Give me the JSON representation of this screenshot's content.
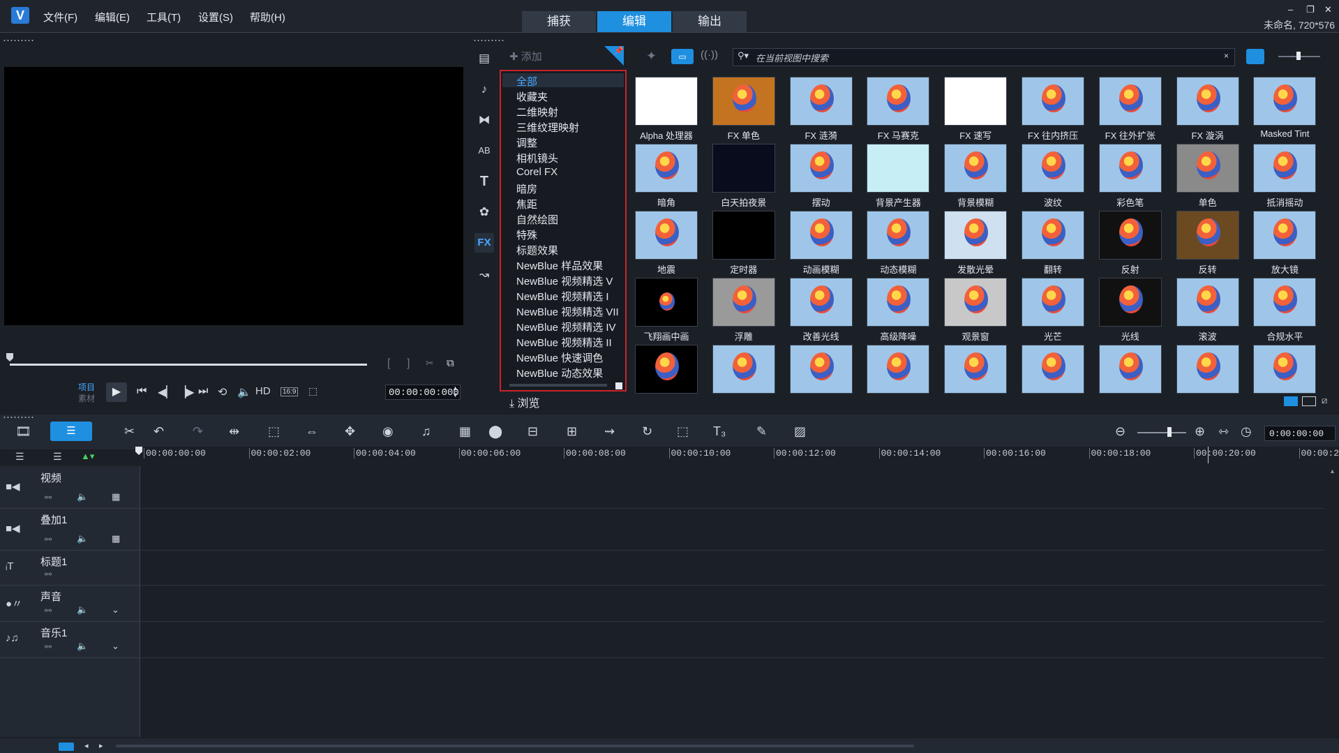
{
  "app": {
    "logo": "V",
    "caption": "未命名, 720*576"
  },
  "menu": [
    "文件(F)",
    "编辑(E)",
    "工具(T)",
    "设置(S)",
    "帮助(H)"
  ],
  "step_tabs": [
    "捕获",
    "编辑",
    "输出"
  ],
  "window_controls": {
    "min": "–",
    "restore": "❐",
    "close": "✕"
  },
  "preview": {
    "mode_project": "项目",
    "mode_clip": "素材",
    "hd": "HD",
    "aspect": "16:9",
    "timecode": "00:00:00:000"
  },
  "library": {
    "add_label": "添加",
    "browse_label": "浏览",
    "search_placeholder": "在当前视图中搜索",
    "fx_label": "FX",
    "categories": [
      "全部",
      "收藏夹",
      "二维映射",
      "三维纹理映射",
      "调整",
      "相机镜头",
      "Corel FX",
      "暗房",
      "焦距",
      "自然绘图",
      "特殊",
      "标题效果",
      "NewBlue 样品效果",
      "NewBlue 视频精选 V",
      "NewBlue 视频精选 I",
      "NewBlue 视频精选 VII",
      "NewBlue 视频精选 IV",
      "NewBlue 视频精选 II",
      "NewBlue 快速调色",
      "NewBlue 动态效果"
    ],
    "selected_category": "全部",
    "effects": [
      [
        "Alpha 处理器",
        "FX 单色",
        "FX 涟漪",
        "FX 马赛克",
        "FX 速写",
        "FX 往内挤压",
        "FX 往外扩张",
        "FX 漩涡",
        "Masked Tint"
      ],
      [
        "暗角",
        "白天拍夜景",
        "摆动",
        "背景产生器",
        "背景模糊",
        "波纹",
        "彩色笔",
        "单色",
        "抵消摇动"
      ],
      [
        "地震",
        "定时器",
        "动画模糊",
        "动态模糊",
        "发散光晕",
        "翻转",
        "反射",
        "反转",
        "放大镜"
      ],
      [
        "飞翔画中画",
        "浮雕",
        "改善光线",
        "高级降噪",
        "观景窗",
        "光芒",
        "光线",
        "滚波",
        "合规水平"
      ],
      [
        "",
        "",
        "",
        "",
        "",
        "",
        "",
        "",
        ""
      ]
    ]
  },
  "timeline": {
    "timecode": "0:00:00:00",
    "ruler": [
      "00:00:00:00",
      "00:00:02:00",
      "00:00:04:00",
      "00:00:06:00",
      "00:00:08:00",
      "00:00:10:00",
      "00:00:12:00",
      "00:00:14:00",
      "00:00:16:00",
      "00:00:18:00",
      "00:00:20:00",
      "00:00:2"
    ],
    "tracks": [
      {
        "name": "视频",
        "icon": "video-track-icon"
      },
      {
        "name": "叠加1",
        "icon": "overlay-track-icon"
      },
      {
        "name": "标题1",
        "icon": "title-track-icon"
      },
      {
        "name": "声音",
        "icon": "voice-track-icon"
      },
      {
        "name": "音乐1",
        "icon": "music-track-icon"
      }
    ]
  },
  "colors": {
    "accent": "#1f8fe0",
    "category_border": "#c8242b",
    "selected_text": "#49a8ff"
  }
}
